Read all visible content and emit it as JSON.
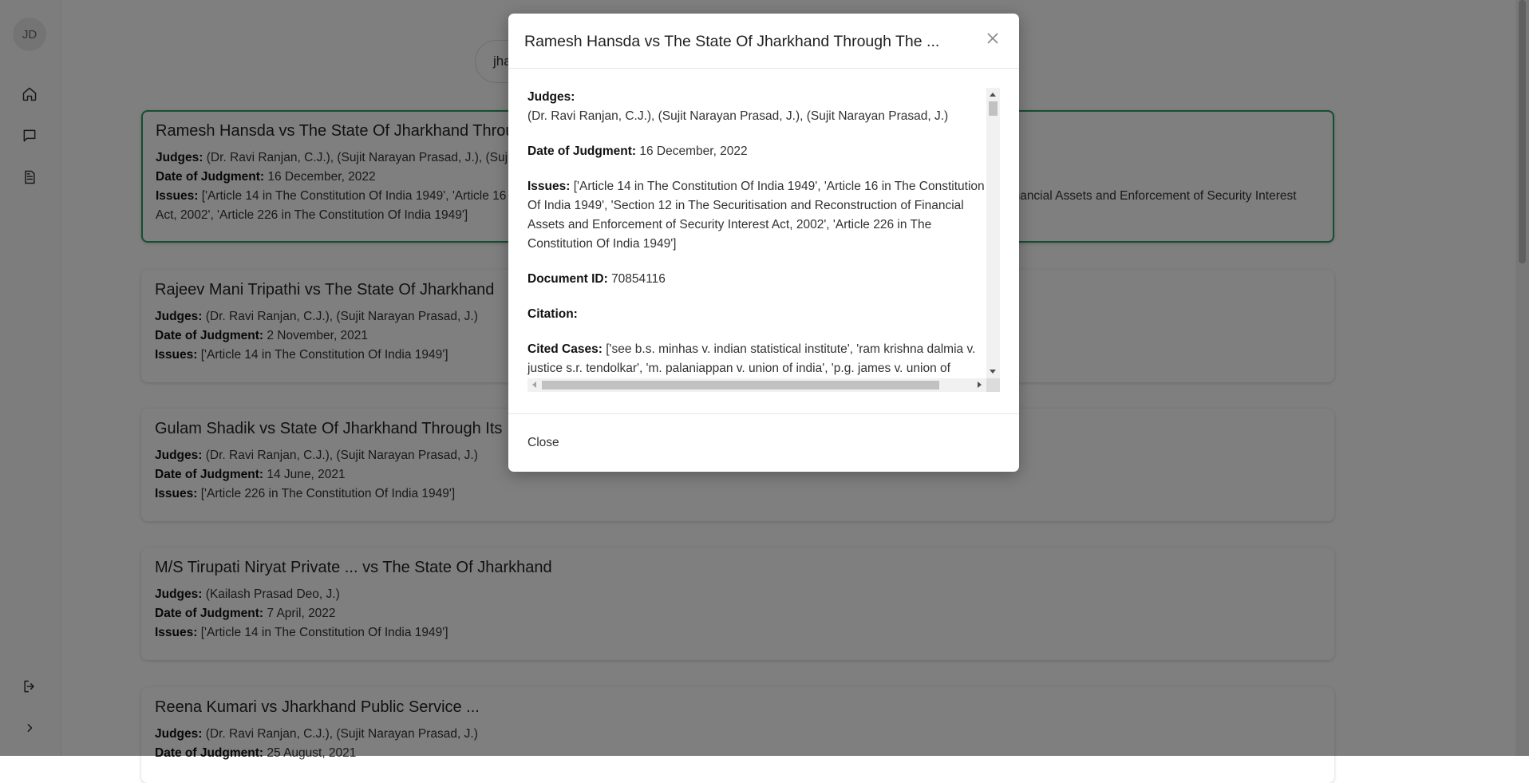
{
  "sidebar": {
    "avatar": "JD",
    "icons": [
      "home-icon",
      "chat-icon",
      "document-icon",
      "logout-icon",
      "chevron-right-icon"
    ]
  },
  "search": {
    "value": "jharkhand"
  },
  "labels": {
    "judges": "Judges:",
    "date": "Date of Judgment:",
    "issues": "Issues:"
  },
  "cards": [
    {
      "title": "Ramesh Hansda vs The State Of Jharkhand Through The Principal Secretary",
      "judges": "(Dr. Ravi Ranjan, C.J.), (Sujit Narayan Prasad, J.), (Sujit Narayan Prasad, J.)",
      "date": "16 December, 2022",
      "issues": "['Article 14 in The Constitution Of India 1949', 'Article 16 in The Constitution Of India 1949', 'Section 12 in The Securitisation and Reconstruction of Financial Assets and Enforcement of Security Interest Act, 2002', 'Article 226 in The Constitution Of India 1949']"
    },
    {
      "title": "Rajeev Mani Tripathi vs The State Of Jharkhand",
      "judges": "(Dr. Ravi Ranjan, C.J.), (Sujit Narayan Prasad, J.)",
      "date": "2 November, 2021",
      "issues": "['Article 14 in The Constitution Of India 1949']"
    },
    {
      "title": "Gulam Shadik vs State Of Jharkhand Through Its",
      "judges": "(Dr. Ravi Ranjan, C.J.), (Sujit Narayan Prasad, J.)",
      "date": "14 June, 2021",
      "issues": "['Article 226 in The Constitution Of India 1949']"
    },
    {
      "title": "M/S Tirupati Niryat Private ... vs The State Of Jharkhand",
      "judges": "(Kailash Prasad Deo, J.)",
      "date": "7 April, 2022",
      "issues": "['Article 14 in The Constitution Of India 1949']"
    },
    {
      "title": "Reena Kumari vs Jharkhand Public Service ...",
      "judges": "(Dr. Ravi Ranjan, C.J.), (Sujit Narayan Prasad, J.)",
      "date": "25 August, 2021",
      "issues": ""
    }
  ],
  "modal": {
    "title": "Ramesh Hansda vs The State Of Jharkhand Through The ...",
    "judges_label": "Judges:",
    "judges": "(Dr. Ravi Ranjan, C.J.), (Sujit Narayan Prasad, J.), (Sujit Narayan Prasad, J.)",
    "date_label": "Date of Judgment:",
    "date": "16 December, 2022",
    "issues_label": "Issues:",
    "issues": "['Article 14 in The Constitution Of India 1949', 'Article 16 in The Constitution Of India 1949', 'Section 12 in The Securitisation and Reconstruction of Financial Assets and Enforcement of Security Interest Act, 2002', 'Article 226 in The Constitution Of India 1949']",
    "docid_label": "Document ID:",
    "docid": "70854116",
    "citation_label": "Citation:",
    "citation": "",
    "cited_label": "Cited Cases:",
    "cited": "['see b.s. minhas v. indian statistical institute', 'ram krishna dalmia v. justice s.r. tendolkar', 'm. palaniappan v. union of india', 'p.g. james v. union of india', 'vide preeti srivastava v. state of m.p']",
    "close_label": "Close"
  }
}
